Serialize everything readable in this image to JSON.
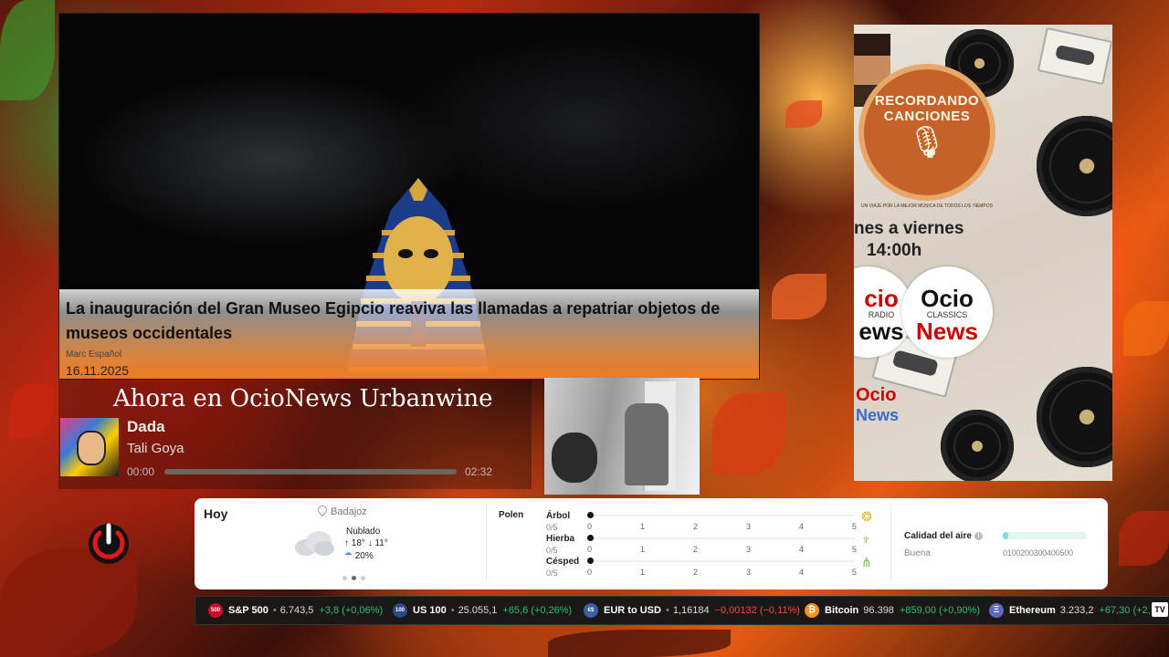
{
  "news": {
    "headline": "La inauguración del Gran Museo Egipcio reaviva las llamadas a repatriar objetos de museos occidentales",
    "author": "Marc Español",
    "date": "16.11.2025"
  },
  "now_playing": {
    "title": "Ahora en OcioNews Urbanwine",
    "song": "Dada",
    "artist": "Tali Goya",
    "time_current": "00:00",
    "time_total": "02:32",
    "progress": 0
  },
  "radio_ad": {
    "badge_title": "RECORDANDO CANCIONES",
    "badge_subtitle": "UN VIAJE POR LA MEJOR MÚSICA DE TODOS LOS TIEMPOS",
    "schedule_line1": "nes a viernes",
    "schedule_line2": "14:00h",
    "logo_left_main": "cio",
    "logo_left_sub": "RADIO",
    "logo_left_bottom": "ews",
    "logo_right_main": "Ocio",
    "logo_right_sub": "CLASSICS",
    "logo_right_bottom": "News",
    "logo_bottom_main": "Ocio",
    "logo_bottom_sub": "News"
  },
  "weather": {
    "today_label": "Hoy",
    "location": "Badajoz",
    "condition": "Nublado",
    "temps": "↑ 18°  ↓ 11°",
    "rain": "20%",
    "carousel_pages": 3,
    "carousel_active": 1,
    "pollen": {
      "label": "Polen",
      "rows": [
        {
          "name": "Árbol",
          "value": "0/5",
          "level": 0,
          "icon": "tree-icon"
        },
        {
          "name": "Hierba",
          "value": "0/5",
          "level": 0,
          "icon": "grass-icon"
        },
        {
          "name": "Césped",
          "value": "0/5",
          "level": 0,
          "icon": "lawn-icon"
        }
      ],
      "scale": [
        "0",
        "1",
        "2",
        "3",
        "4",
        "5"
      ]
    },
    "air_quality": {
      "label": "Calidad del aire",
      "status": "Buena",
      "scale": "0100200300400500",
      "level": 0.06
    }
  },
  "ticker": [
    {
      "badge": "500",
      "badge_color": "#c8102e",
      "name": "S&P 500",
      "price": "6.743,5",
      "change": "+3,8 (+0,06%)",
      "negative": false
    },
    {
      "badge": "100",
      "badge_color": "#2a4a8a",
      "name": "US 100",
      "price": "25.055,1",
      "change": "+65,6 (+0,26%)",
      "negative": false
    },
    {
      "badge": "€$",
      "badge_color": "#3b5fa8",
      "name": "EUR to USD",
      "price": "1,16184",
      "change": "−0,00132 (−0,11%)",
      "negative": true
    },
    {
      "badge": "₿",
      "badge_color": "#f7931a",
      "name": "Bitcoin",
      "price": "96.398",
      "change": "+859,00 (+0,90%)",
      "negative": false
    },
    {
      "badge": "Ξ",
      "badge_color": "#5c6bc0",
      "name": "Ethereum",
      "price": "3.233,2",
      "change": "+67,30 (+2,",
      "negative": false
    }
  ],
  "ticker_logo": "TV",
  "colors": {
    "power_red": "#e01818",
    "positive": "#2fbf71",
    "negative": "#f04b4b",
    "badge_orange": "#c5622a"
  }
}
